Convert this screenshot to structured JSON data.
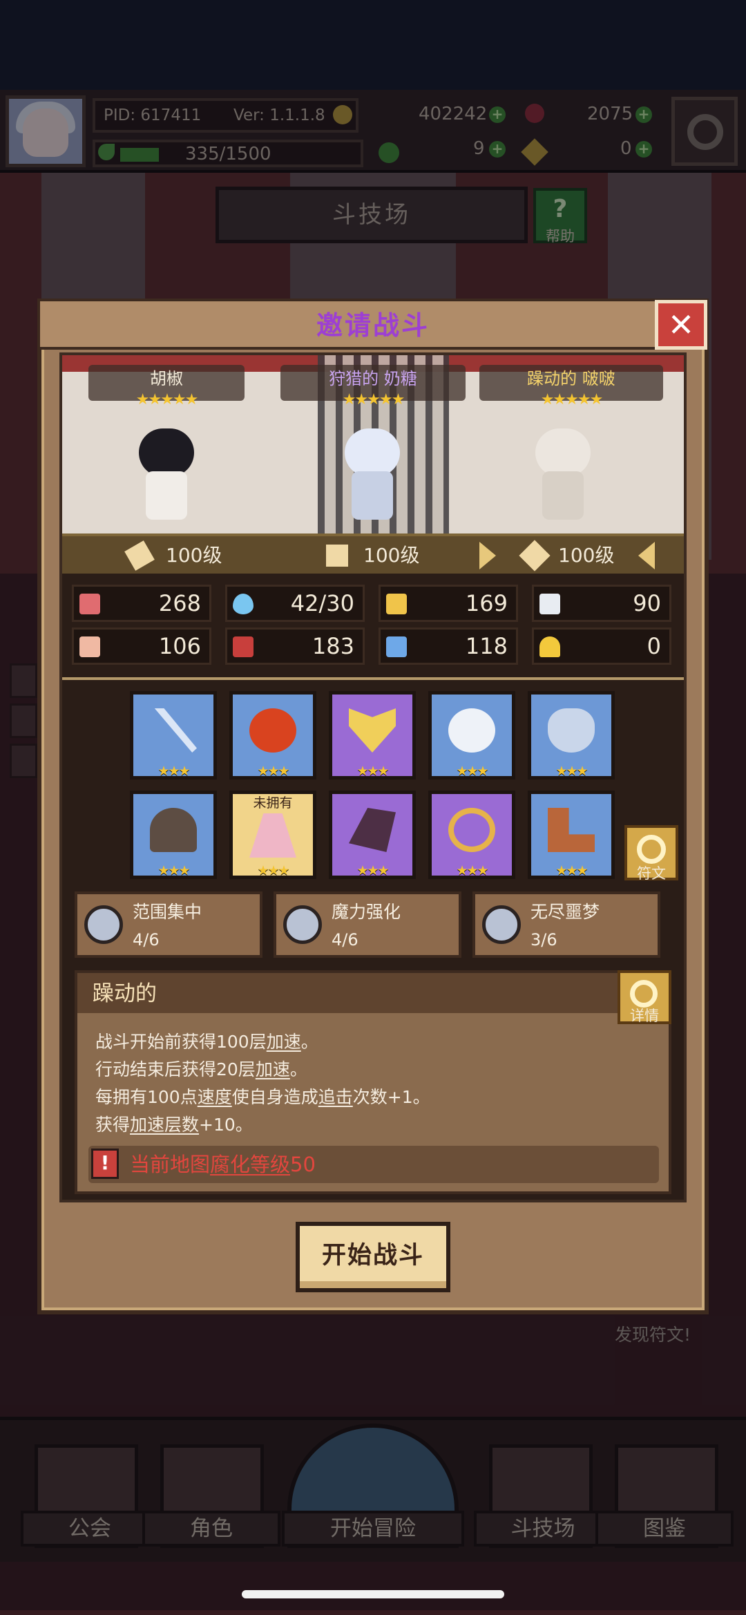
{
  "top_bar": {
    "pid": "PID: 617411",
    "version": "Ver: 1.1.1.8",
    "gold": "402242",
    "gems": "2075",
    "xp": "335/1500",
    "clover": "9",
    "keys": "0"
  },
  "arena": {
    "title": "斗技场",
    "help_label": "帮助"
  },
  "dialog": {
    "title": "邀请战斗",
    "characters": [
      {
        "name": "胡椒",
        "stars": "★★★★★",
        "level": "100级"
      },
      {
        "name": "狩猎的 奶糖",
        "stars": "★★★★★",
        "level": "100级"
      },
      {
        "name": "躁动的 啵啵",
        "stars": "★★★★★",
        "level": "100级"
      }
    ],
    "stats": [
      {
        "icon": "heart-icon",
        "value": "268"
      },
      {
        "icon": "mana-drop-icon",
        "value": "42/30"
      },
      {
        "icon": "shield-icon",
        "value": "169"
      },
      {
        "icon": "wing-icon",
        "value": "90"
      },
      {
        "icon": "fist-icon",
        "value": "106"
      },
      {
        "icon": "spellbook-icon",
        "value": "183"
      },
      {
        "icon": "scroll-icon",
        "value": "118"
      },
      {
        "icon": "horseshoe-icon",
        "value": "0"
      }
    ],
    "equipment": [
      {
        "icon": "staff-icon",
        "rarity": "blue",
        "stars": "★★★"
      },
      {
        "icon": "fire-orb-icon",
        "rarity": "blue",
        "stars": "★★★"
      },
      {
        "icon": "heart-amulet-icon",
        "rarity": "purple",
        "stars": "★★★"
      },
      {
        "icon": "gem-medallion-icon",
        "rarity": "blue",
        "stars": "★★★"
      },
      {
        "icon": "ring-icon",
        "rarity": "blue",
        "stars": "★★★"
      },
      {
        "icon": "hood-icon",
        "rarity": "blue",
        "stars": "★★★"
      },
      {
        "icon": "dress-icon",
        "rarity": "gold",
        "stars": "★★★",
        "tag": "未拥有"
      },
      {
        "icon": "glove-icon",
        "rarity": "purple",
        "stars": "★★★"
      },
      {
        "icon": "belt-icon",
        "rarity": "purple",
        "stars": "★★★"
      },
      {
        "icon": "boots-icon",
        "rarity": "blue",
        "stars": "★★★"
      }
    ],
    "rune_label": "符文",
    "sets": [
      {
        "name": "范围集中",
        "progress": "4/6"
      },
      {
        "name": "魔力强化",
        "progress": "4/6"
      },
      {
        "name": "无尽噩梦",
        "progress": "3/6"
      }
    ],
    "trait": {
      "title": "躁动的",
      "detail_label": "详情",
      "l1a": "战斗开始前获得100层",
      "l1b": "加速",
      "l1c": "。",
      "l2a": "行动结束后获得20层",
      "l2b": "加速",
      "l2c": "。",
      "l3a": "每拥有100点",
      "l3b": "速度",
      "l3c": "使自身造成",
      "l3d": "追击",
      "l3e": "次数+1。",
      "l4a": "获得",
      "l4b": "加速层数",
      "l4c": "+10。",
      "warning_a": "当前地图",
      "warning_b": "腐化等级",
      "warning_c": "50"
    },
    "start_button": "开始战斗"
  },
  "background": {
    "discover_text": "发现符文!"
  },
  "bottom_nav": {
    "guild": "公会",
    "character": "角色",
    "adventure": "开始冒险",
    "arena": "斗技场",
    "codex": "图鉴"
  },
  "colors": {
    "title_purple": "#9d3fd3",
    "warning_red": "#e3463e",
    "star_gold": "#f4c431"
  }
}
